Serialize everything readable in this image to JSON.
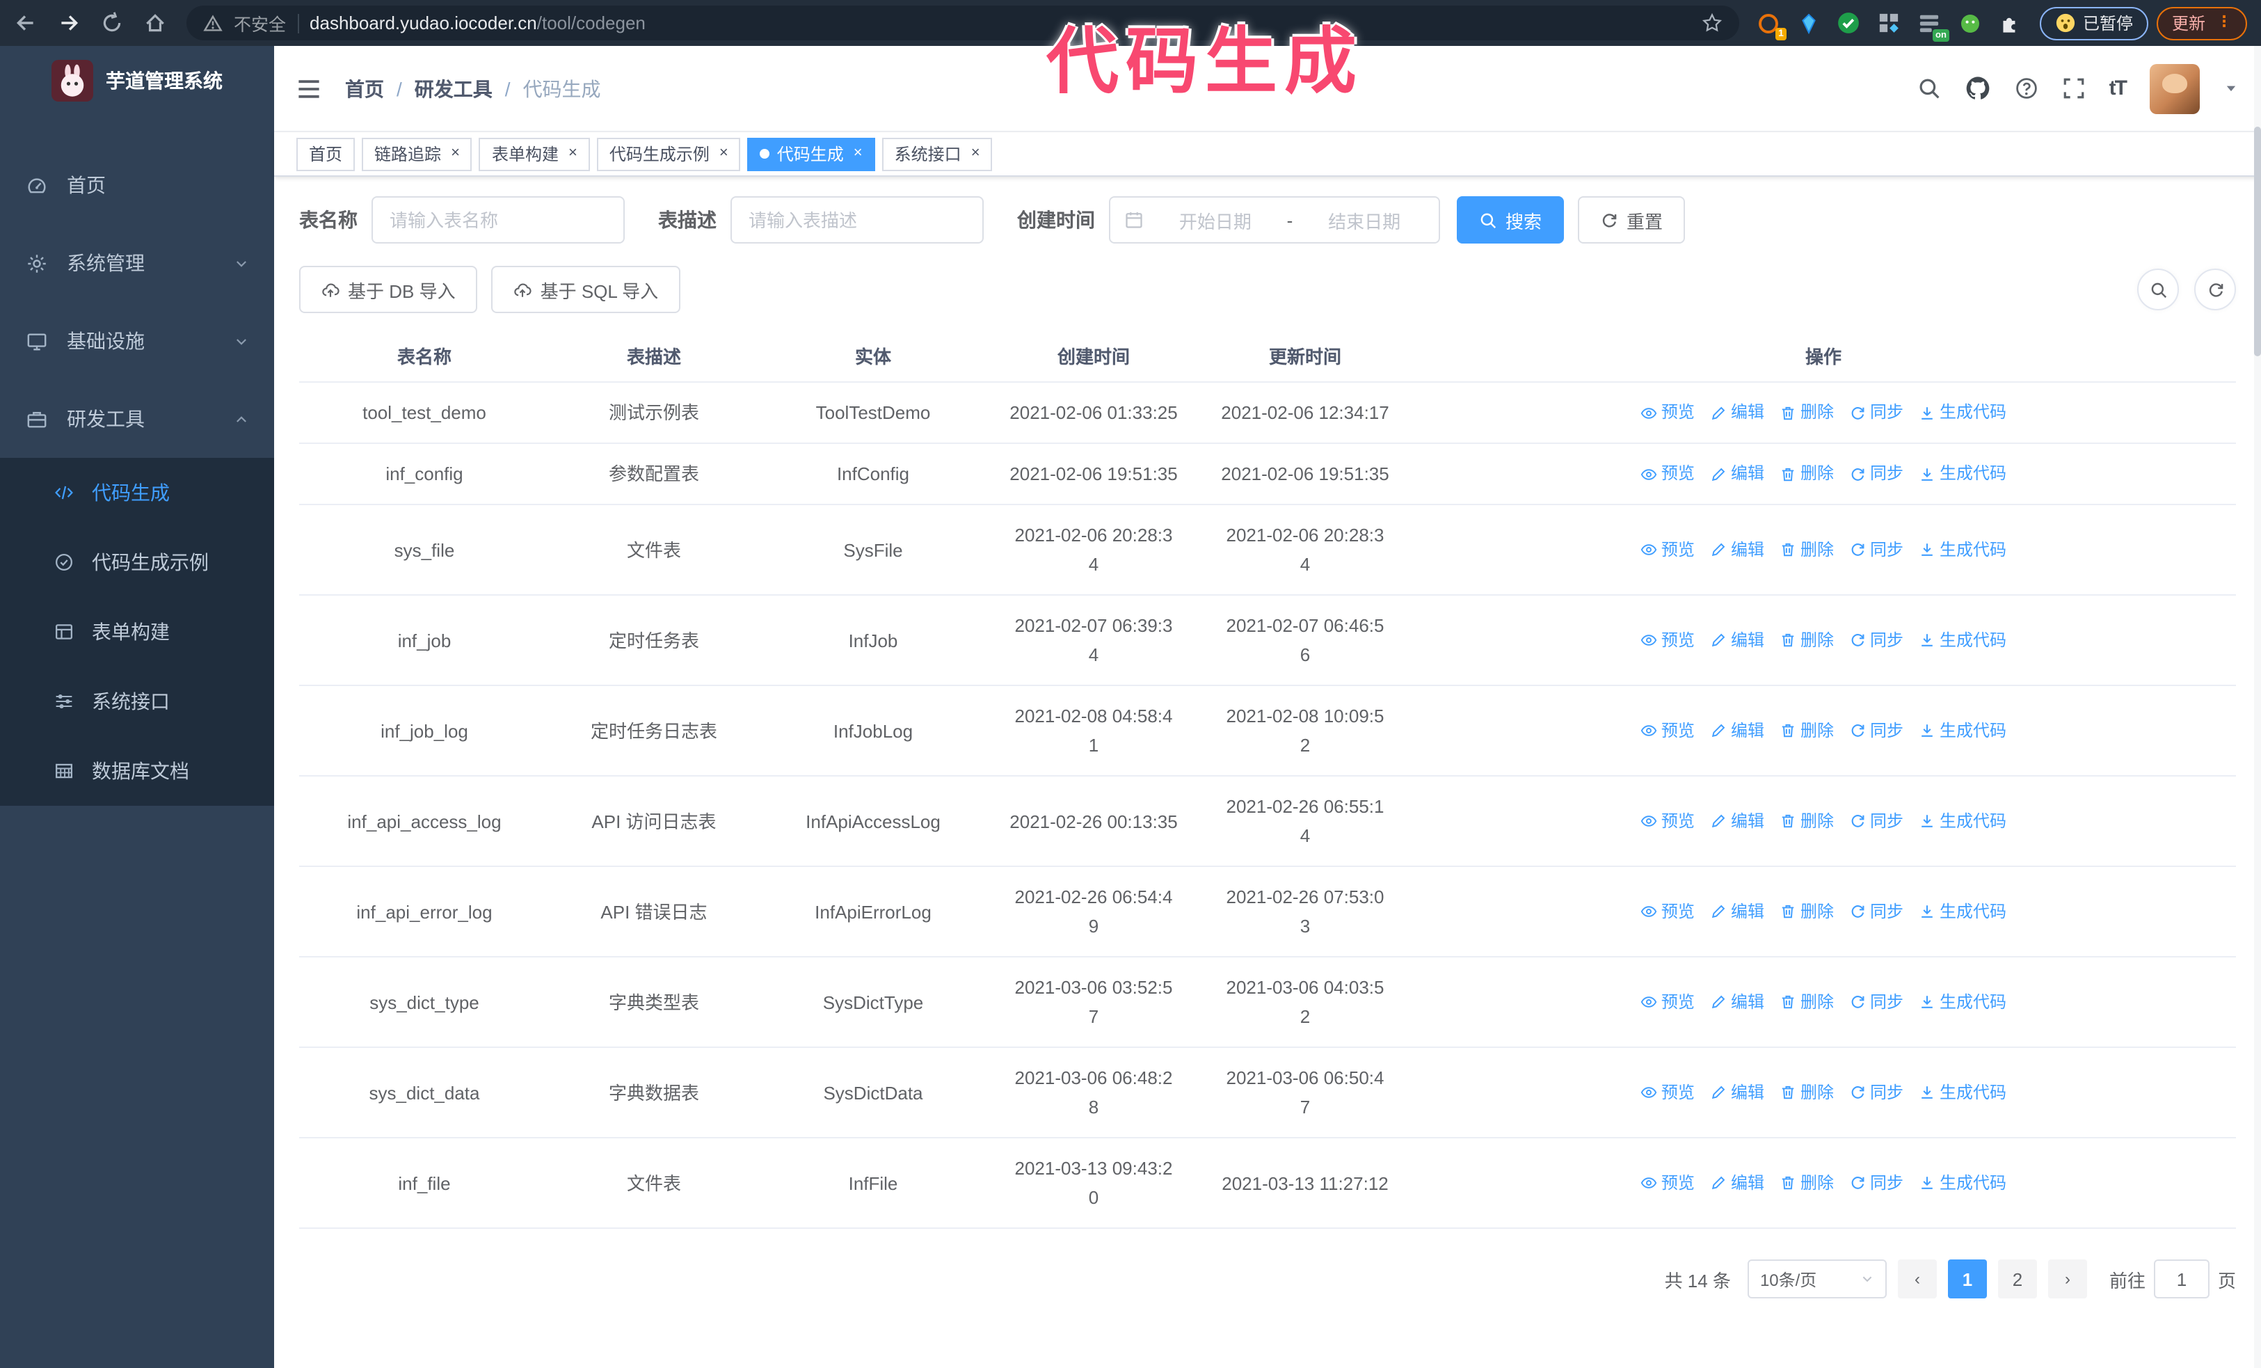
{
  "colors": {
    "accent": "#409EFF",
    "sidebar_bg": "#304156",
    "submenu_bg": "#1f2d3d",
    "annotation": "#f84870",
    "browser_bg": "#232e3b"
  },
  "browser": {
    "security_label": "不安全",
    "url_host": "dashboard.yudao.iocoder.cn",
    "url_path": "/tool/codegen",
    "extension_badge_1": "1",
    "extension_on_badge": "on",
    "paused_badge": "已暂停",
    "update_button": "更新"
  },
  "annotation": {
    "text": "代码生成"
  },
  "sidebar": {
    "logo_title": "芋道管理系统",
    "items": [
      {
        "label": "首页",
        "icon": "dashboard"
      },
      {
        "label": "系统管理",
        "icon": "gear",
        "chevron": "down"
      },
      {
        "label": "基础设施",
        "icon": "monitor",
        "chevron": "down"
      },
      {
        "label": "研发工具",
        "icon": "briefcase",
        "chevron": "up"
      }
    ],
    "subitems": [
      {
        "label": "代码生成",
        "icon": "code",
        "active": true
      },
      {
        "label": "代码生成示例",
        "icon": "badge"
      },
      {
        "label": "表单构建",
        "icon": "form"
      },
      {
        "label": "系统接口",
        "icon": "sliders"
      },
      {
        "label": "数据库文档",
        "icon": "db"
      }
    ]
  },
  "header": {
    "breadcrumb": [
      "首页",
      "研发工具",
      "代码生成"
    ],
    "text_size_icon_label": "tT"
  },
  "tags": [
    {
      "label": "首页",
      "closable": false,
      "active": false
    },
    {
      "label": "链路追踪",
      "closable": true,
      "active": false
    },
    {
      "label": "表单构建",
      "closable": true,
      "active": false
    },
    {
      "label": "代码生成示例",
      "closable": true,
      "active": false
    },
    {
      "label": "代码生成",
      "closable": true,
      "active": true
    },
    {
      "label": "系统接口",
      "closable": true,
      "active": false
    }
  ],
  "search": {
    "name_label": "表名称",
    "name_placeholder": "请输入表名称",
    "desc_label": "表描述",
    "desc_placeholder": "请输入表描述",
    "time_label": "创建时间",
    "start_placeholder": "开始日期",
    "range_separator": "-",
    "end_placeholder": "结束日期",
    "search_button": "搜索",
    "reset_button": "重置"
  },
  "toolbar": {
    "import_db": "基于 DB 导入",
    "import_sql": "基于 SQL 导入"
  },
  "table": {
    "columns": [
      "表名称",
      "表描述",
      "实体",
      "创建时间",
      "更新时间",
      "操作"
    ],
    "actions": [
      {
        "label": "预览",
        "icon": "eye",
        "name": "action-preview"
      },
      {
        "label": "编辑",
        "icon": "edit",
        "name": "action-edit"
      },
      {
        "label": "删除",
        "icon": "trash",
        "name": "action-delete"
      },
      {
        "label": "同步",
        "icon": "sync",
        "name": "action-sync"
      },
      {
        "label": "生成代码",
        "icon": "download",
        "name": "action-generate"
      }
    ],
    "rows": [
      {
        "name": "tool_test_demo",
        "desc": "测试示例表",
        "entity": "ToolTestDemo",
        "created": "2021-02-06 01:33:25",
        "updated": "2021-02-06 12:34:17"
      },
      {
        "name": "inf_config",
        "desc": "参数配置表",
        "entity": "InfConfig",
        "created": "2021-02-06 19:51:35",
        "updated": "2021-02-06 19:51:35"
      },
      {
        "name": "sys_file",
        "desc": "文件表",
        "entity": "SysFile",
        "created": "2021-02-06 20:28:3\n4",
        "updated": "2021-02-06 20:28:3\n4"
      },
      {
        "name": "inf_job",
        "desc": "定时任务表",
        "entity": "InfJob",
        "created": "2021-02-07 06:39:3\n4",
        "updated": "2021-02-07 06:46:5\n6"
      },
      {
        "name": "inf_job_log",
        "desc": "定时任务日志表",
        "entity": "InfJobLog",
        "created": "2021-02-08 04:58:4\n1",
        "updated": "2021-02-08 10:09:5\n2"
      },
      {
        "name": "inf_api_access_log",
        "desc": "API 访问日志表",
        "entity": "InfApiAccessLog",
        "created": "2021-02-26 00:13:35",
        "updated": "2021-02-26 06:55:1\n4"
      },
      {
        "name": "inf_api_error_log",
        "desc": "API 错误日志",
        "entity": "InfApiErrorLog",
        "created": "2021-02-26 06:54:4\n9",
        "updated": "2021-02-26 07:53:0\n3"
      },
      {
        "name": "sys_dict_type",
        "desc": "字典类型表",
        "entity": "SysDictType",
        "created": "2021-03-06 03:52:5\n7",
        "updated": "2021-03-06 04:03:5\n2"
      },
      {
        "name": "sys_dict_data",
        "desc": "字典数据表",
        "entity": "SysDictData",
        "created": "2021-03-06 06:48:2\n8",
        "updated": "2021-03-06 06:50:4\n7"
      },
      {
        "name": "inf_file",
        "desc": "文件表",
        "entity": "InfFile",
        "created": "2021-03-13 09:43:2\n0",
        "updated": "2021-03-13 11:27:12"
      }
    ]
  },
  "pagination": {
    "total": "共 14 条",
    "page_size": "10条/页",
    "prev": "‹",
    "next": "›",
    "pages": [
      "1",
      "2"
    ],
    "active_page": "1",
    "goto_label": "前往",
    "goto_value": "1",
    "goto_suffix": "页"
  }
}
